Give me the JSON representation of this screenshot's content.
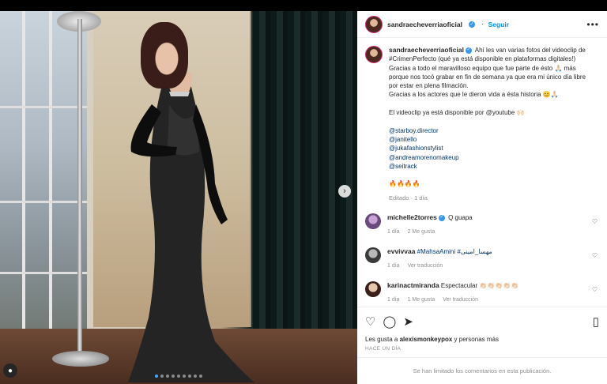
{
  "post": {
    "username": "sandraecheverriaoficial",
    "follow_label": "Seguir",
    "more_label": "•••",
    "next_label": "›",
    "caption_lines": [
      "Ahí les van varias fotos del videoclip de #CrimenPerfecto (qué ya está disponible en plataformas digitales!)",
      "Gracias a todo el maravilloso equipo que fue parte de ésto 🙏🏻 más porque nos tocó grabar en fin de semana ya que era mi único día libre por estar en plena filmación.",
      "Gracias a los actores que le dieron vida a ésta historia 😊🙏🏻",
      "",
      "El videoclip ya está disponible por @youtube 🙌🏻",
      "",
      "@starboy.director",
      "@janitello",
      "@jukafashionstylist",
      "@andreamorenomakeup",
      "@seitrack",
      "",
      "🔥🔥🔥🔥"
    ],
    "caption_meta": "Editado · 1 día",
    "likes_text": "Les gusta a ",
    "likes_user": "alexismonkeypox",
    "likes_rest": " y personas más",
    "time_ago": "HACE UN DÍA",
    "comments_limited": "Se han limitado los comentarios en esta publicación."
  },
  "comments": [
    {
      "user": "michelle2torres",
      "verified": true,
      "text": " Q guapa",
      "meta": [
        "1 día",
        "2 Me gusta"
      ]
    },
    {
      "user": "evvivvaa",
      "verified": false,
      "text": " #MahsaAmini #مهسا_امینی",
      "meta": [
        "1 día",
        "Ver traducción"
      ]
    },
    {
      "user": "karinactmiranda",
      "verified": false,
      "text": " Espectacular 👏🏻👏🏻👏🏻👏🏻👏🏻",
      "meta": [
        "1 día",
        "1 Me gusta",
        "Ver traducción"
      ]
    }
  ],
  "icons": {
    "heart": "heart-icon",
    "comment": "comment-icon",
    "share": "share-icon",
    "bookmark": "bookmark-icon"
  },
  "colors": {
    "accent": "#0095f6",
    "link": "#00376b",
    "muted": "#8e8e8e"
  }
}
